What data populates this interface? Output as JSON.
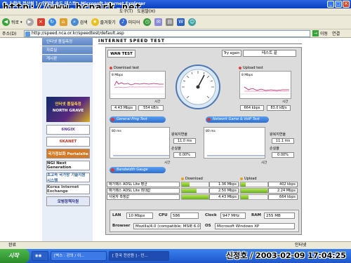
{
  "window": {
    "title": "[ 한국 전산원 ] - 인터넷 속도 테스트 - Microsoft Internet Explorer",
    "watermark": "http://www.bcpark.net"
  },
  "menu": {
    "tools": "도구(T)",
    "help": "도움말(H)"
  },
  "toolbar": {
    "back": "뒤로",
    "search": "검색",
    "favorites": "즐겨찾기",
    "media": "미디어"
  },
  "address": {
    "label": "주소(D)",
    "url": "http://speed.nca.or.kr/speedtest/default.asp",
    "go": "이동",
    "links": "연결"
  },
  "nav": {
    "items": [
      "인터넷 품질측정",
      "자료실",
      "게시판"
    ]
  },
  "banners": {
    "hero_line1": "인터넷 품질측정",
    "hero_line2": "NORTH GRAVE",
    "b1": "6NGIX",
    "b2": "6KANET",
    "b3": "국가정보화 Portalsite",
    "b4": "NGI Next Generation",
    "b5": "초고속 국가망 기술지원 시스템",
    "b6": "Korea Internet Exchange",
    "b7": "모범정책자원"
  },
  "speed": {
    "title": "INTERNET SPEED TEST",
    "tab": "WAN TEST",
    "try_again": "Try again",
    "status": "테스트 끝",
    "download": {
      "label": "Download test",
      "axis_top": "8 Mbps",
      "time_label": "시간",
      "value": "4.43 Mbps",
      "kbps": "554 kB/s"
    },
    "upload": {
      "label": "Upload test",
      "axis_top": "8 Mbps",
      "time_label": "시간",
      "value": "664 kbps",
      "kbps": "83.0 kB/s"
    },
    "ping": {
      "title": "General Ping Test",
      "axis_top": "80 ms",
      "rtt_label": "왕복지연율",
      "rtt": "11.0 ms",
      "loss_label": "손실율",
      "loss": "0.00%",
      "time_label": "시간"
    },
    "game": {
      "title": "Network Game & VoIP Test",
      "axis_top": "80 ms",
      "rtt_label": "왕복지연율",
      "rtt": "11.1 ms",
      "loss_label": "손실율",
      "loss": "0.00%",
      "time_label": "시간"
    },
    "gauge": {
      "title": "Bandwidth Gauge",
      "download_header": "Download",
      "upload_header": "Upload",
      "rows": [
        {
          "label": "메가패스 ADSL Lite 평균",
          "down": "1.36 Mbps",
          "down_pct": 0.3,
          "up": "402 kbps",
          "up_pct": 0.18
        },
        {
          "label": "메가패스 ADSL Lite 최대값",
          "down": "2.50 Mbps",
          "down_pct": 0.56,
          "up": "2.24 Mbps",
          "up_pct": 1.0
        },
        {
          "label": "사용자 측정값",
          "down": "4.43 Mbps",
          "down_pct": 1.0,
          "up": "664 kbps",
          "up_pct": 0.3
        }
      ]
    },
    "info": {
      "lan_label": "LAN",
      "lan": "10 Mbps",
      "cpu_label": "CPU",
      "cpu": "586",
      "clock_label": "Clock",
      "clock": "947 MHz",
      "ram_label": "RAM",
      "ram": "255 MB",
      "browser_label": "Browser",
      "browser": "Mozilla/4.0 (compatible; MSIE 6.0",
      "os_label": "OS",
      "os": "Microsoft Windows XP"
    }
  },
  "status_bar": {
    "text": "완료",
    "zone": "인터넷"
  },
  "taskbar": {
    "start": "시작",
    "task1": "[벽스 : 강의 / 이...",
    "task2": "[ 한국 전산원 ] - 인..."
  },
  "overlay_date": "신정호 / 2003-02-09 17:04:25"
}
